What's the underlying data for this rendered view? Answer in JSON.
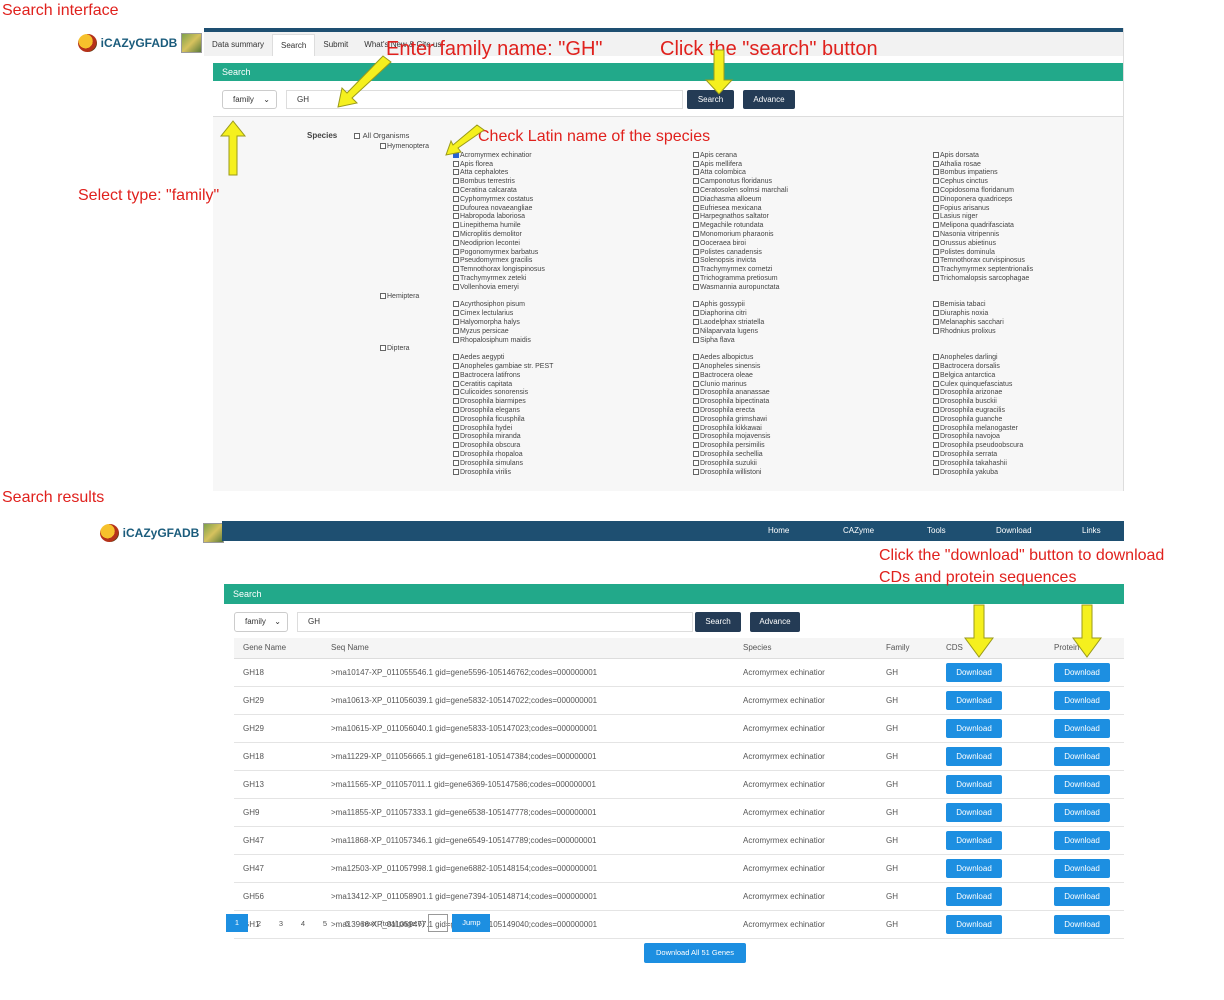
{
  "section_labels": {
    "search_interface": "Search interface",
    "search_results": "Search results"
  },
  "annotations": {
    "enter_family": "Enter family name: \"GH\"",
    "click_search": "Click the \"search\" button",
    "check_latin": "Check  Latin name of the species",
    "select_type": "Select type: \"family\"",
    "click_download_1": "Click the \"download\" button to download",
    "click_download_2": "CDs and protein sequences"
  },
  "colors": {
    "accent": "#22a98a",
    "nav": "#1e4f71",
    "button": "#1d8fe1",
    "annotation": "#e0211d",
    "arrow": "#f5f01e"
  },
  "logo_text": "iCAZyGFADB",
  "top": {
    "tabs": [
      "Data summary",
      "Search",
      "Submit",
      "What's New & Cite us"
    ],
    "panel_title": "Search",
    "select_value": "family",
    "input_value": "GH",
    "search_label": "Search",
    "advance_label": "Advance",
    "species_label": "Species",
    "all_organisms": "All Organisms",
    "orders": [
      "Hymenoptera",
      "Hemiptera",
      "Diptera"
    ],
    "hymenoptera": [
      [
        "Acromyrmex echinatior",
        "Apis cerana",
        "Apis dorsata"
      ],
      [
        "Apis florea",
        "Apis mellifera",
        "Athalia rosae"
      ],
      [
        "Atta cephalotes",
        "Atta colombica",
        "Bombus impatiens"
      ],
      [
        "Bombus terrestris",
        "Camponotus floridanus",
        "Cephus cinctus"
      ],
      [
        "Ceratina calcarata",
        "Ceratosolen solmsi marchali",
        "Copidosoma floridanum"
      ],
      [
        "Cyphomyrmex costatus",
        "Diachasma alloeum",
        "Dinoponera quadriceps"
      ],
      [
        "Dufourea novaeangliae",
        "Eufriesea mexicana",
        "Fopius arisanus"
      ],
      [
        "Habropoda laboriosa",
        "Harpegnathos saltator",
        "Lasius niger"
      ],
      [
        "Linepithema humile",
        "Megachile rotundata",
        "Melipona quadrifasciata"
      ],
      [
        "Microplitis demolitor",
        "Monomorium pharaonis",
        "Nasonia vitripennis"
      ],
      [
        "Neodiprion lecontei",
        "Ooceraea biroi",
        "Orussus abietinus"
      ],
      [
        "Pogonomyrmex barbatus",
        "Polistes canadensis",
        "Polistes dominula"
      ],
      [
        "Pseudomyrmex gracilis",
        "Solenopsis invicta",
        "Temnothorax curvispinosus"
      ],
      [
        "Temnothorax longispinosus",
        "Trachymyrmex cornetzi",
        "Trachymyrmex septentrionalis"
      ],
      [
        "Trachymyrmex zeteki",
        "Trichogramma pretiosum",
        "Trichomalopsis sarcophagae"
      ],
      [
        "Vollenhovia emeryi",
        "Wasmannia auropunctata",
        ""
      ]
    ],
    "hemiptera": [
      [
        "Acyrthosiphon pisum",
        "Aphis gossypii",
        "Bemisia tabaci"
      ],
      [
        "Cimex lectularius",
        "Diaphorina citri",
        "Diuraphis noxia"
      ],
      [
        "Halyomorpha halys",
        "Laodelphax striatella",
        "Melanaphis sacchari"
      ],
      [
        "Myzus persicae",
        "Nilaparvata lugens",
        "Rhodnius prolixus"
      ],
      [
        "Rhopalosiphum maidis",
        "Sipha flava",
        ""
      ]
    ],
    "diptera": [
      [
        "Aedes aegypti",
        "Aedes albopictus",
        "Anopheles darlingi"
      ],
      [
        "Anopheles gambiae str. PEST",
        "Anopheles sinensis",
        "Bactrocera dorsalis"
      ],
      [
        "Bactrocera latifrons",
        "Bactrocera oleae",
        "Belgica antarctica"
      ],
      [
        "Ceratitis capitata",
        "Clunio marinus",
        "Culex quinquefasciatus"
      ],
      [
        "Culicoides sonorensis",
        "Drosophila ananassae",
        "Drosophila arizonae"
      ],
      [
        "Drosophila biarmipes",
        "Drosophila bipectinata",
        "Drosophila busckii"
      ],
      [
        "Drosophila elegans",
        "Drosophila erecta",
        "Drosophila eugracilis"
      ],
      [
        "Drosophila ficusphila",
        "Drosophila grimshawi",
        "Drosophila guanche"
      ],
      [
        "Drosophila hydei",
        "Drosophila kikkawai",
        "Drosophila melanogaster"
      ],
      [
        "Drosophila miranda",
        "Drosophila mojavensis",
        "Drosophila navojoa"
      ],
      [
        "Drosophila obscura",
        "Drosophila persimilis",
        "Drosophila pseudoobscura"
      ],
      [
        "Drosophila rhopaloa",
        "Drosophila sechellia",
        "Drosophila serrata"
      ],
      [
        "Drosophila simulans",
        "Drosophila suzukii",
        "Drosophila takahashii"
      ],
      [
        "Drosophila virilis",
        "Drosophila willistoni",
        "Drosophila yakuba"
      ]
    ]
  },
  "bottom": {
    "nav": [
      "Home",
      "CAZyme",
      "Tools",
      "Download",
      "Links"
    ],
    "panel_title": "Search",
    "select_value": "family",
    "input_value": "GH",
    "search_label": "Search",
    "advance_label": "Advance",
    "columns": [
      "Gene Name",
      "Seq Name",
      "Species",
      "Family",
      "CDS",
      "Protein"
    ],
    "rows": [
      [
        "GH18",
        ">ma10147-XP_011055546.1 gid=gene5596-105146762;codes=000000001",
        "Acromyrmex echinatior",
        "GH"
      ],
      [
        "GH29",
        ">ma10613-XP_011056039.1 gid=gene5832-105147022;codes=000000001",
        "Acromyrmex echinatior",
        "GH"
      ],
      [
        "GH29",
        ">ma10615-XP_011056040.1 gid=gene5833-105147023;codes=000000001",
        "Acromyrmex echinatior",
        "GH"
      ],
      [
        "GH18",
        ">ma11229-XP_011056665.1 gid=gene6181-105147384;codes=000000001",
        "Acromyrmex echinatior",
        "GH"
      ],
      [
        "GH13",
        ">ma11565-XP_011057011.1 gid=gene6369-105147586;codes=000000001",
        "Acromyrmex echinatior",
        "GH"
      ],
      [
        "GH9",
        ">ma11855-XP_011057333.1 gid=gene6538-105147778;codes=000000001",
        "Acromyrmex echinatior",
        "GH"
      ],
      [
        "GH47",
        ">ma11868-XP_011057346.1 gid=gene6549-105147789;codes=000000001",
        "Acromyrmex echinatior",
        "GH"
      ],
      [
        "GH47",
        ">ma12503-XP_011057998.1 gid=gene6882-105148154;codes=000000001",
        "Acromyrmex echinatior",
        "GH"
      ],
      [
        "GH56",
        ">ma13412-XP_011058901.1 gid=gene7394-105148714;codes=000000001",
        "Acromyrmex echinatior",
        "GH"
      ],
      [
        "GH1",
        ">ma13966-XP_011059477.1 gid=gene7699-105149040;codes=000000001",
        "Acromyrmex echinatior",
        "GH"
      ]
    ],
    "download_label": "Download",
    "download_all": "Download All 51 Genes",
    "pages": [
      "1",
      "2",
      "3",
      "4",
      "5",
      "6"
    ],
    "next_label": "next",
    "total_label": "(total page:6)",
    "jump_label": "Jump"
  }
}
